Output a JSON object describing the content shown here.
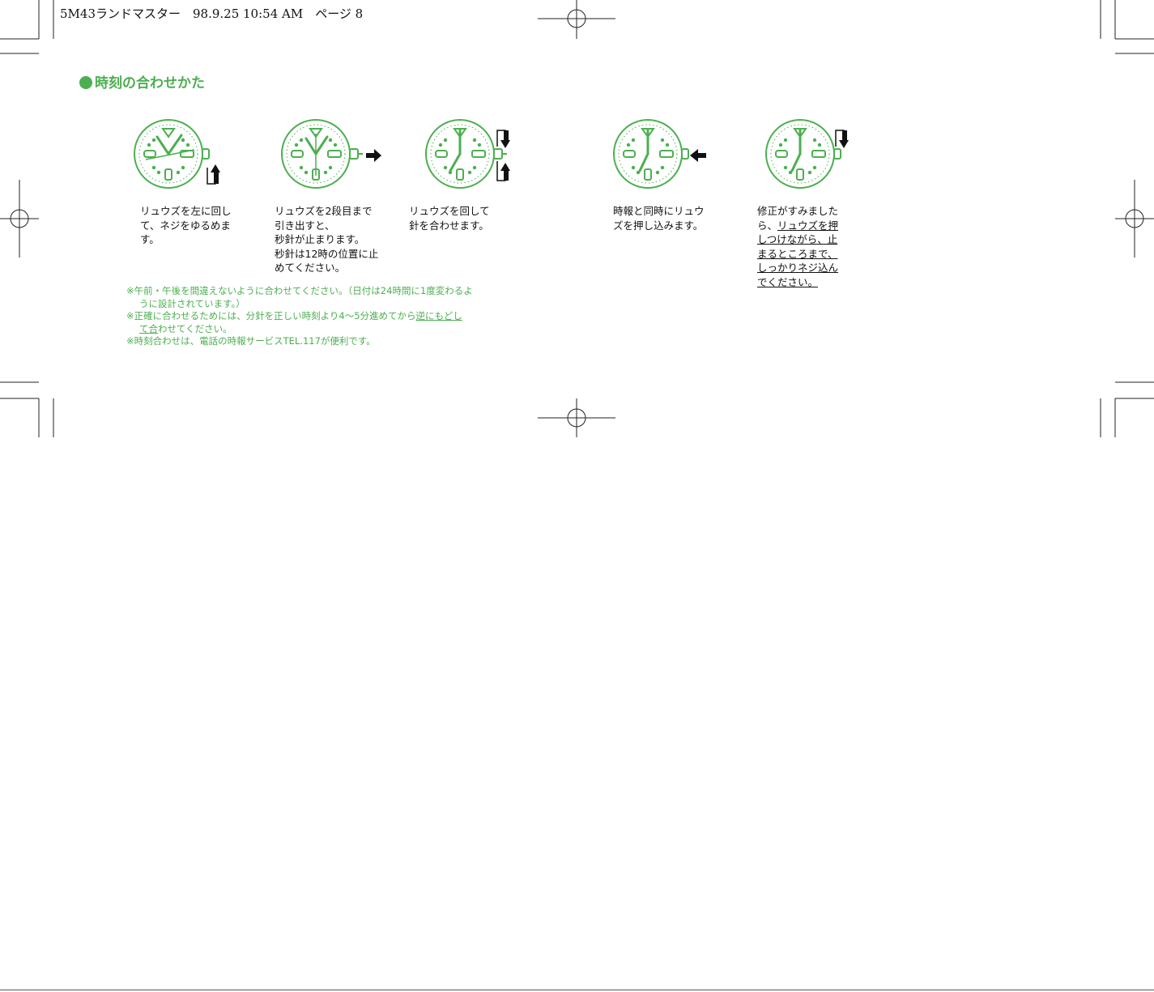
{
  "header": {
    "text": "5M43ランドマスター　98.9.25 10:54 AM　ページ 8"
  },
  "section": {
    "title": "時刻の合わせかた"
  },
  "colors": {
    "accent": "#4caf50",
    "text": "#111111"
  },
  "steps": [
    {
      "lines": [
        "リュウズを左に回し",
        "て、ネジをゆるめま",
        "す。"
      ]
    },
    {
      "lines": [
        "リュウズを2段目まで",
        "引き出すと、",
        "秒針が止まります。",
        "秒針は12時の位置に止",
        "めてください。"
      ]
    },
    {
      "lines": [
        "リュウズを回して",
        "針を合わせます。"
      ]
    },
    {
      "lines": [
        "時報と同時にリュウ",
        "ズを押し込みます。"
      ]
    },
    {
      "lines": [
        "修正がすみました",
        "ら、",
        "リュウズを押",
        "しつけながら、止",
        "まるところまで、",
        "しっかりネジ込ん",
        "でください。"
      ]
    }
  ],
  "notes": [
    "※午前・午後を間違えないように合わせてください。（日付は24時間に1度変わるよ",
    "うに設計されています。）",
    "※正確に合わせるためには、分針を正しい時刻より4〜5分進めてから",
    "逆にもどし",
    "て合",
    "わせてください。",
    "※時刻合わせは、電話の時報サービスTEL.117が便利です。"
  ],
  "icons": {
    "registration": "crosshair-registration-mark",
    "watch": "watch-dial-icon",
    "arrow_out": "arrow-right-icon",
    "arrow_in": "arrow-left-icon",
    "rotate": "rotate-arrow-icon"
  }
}
